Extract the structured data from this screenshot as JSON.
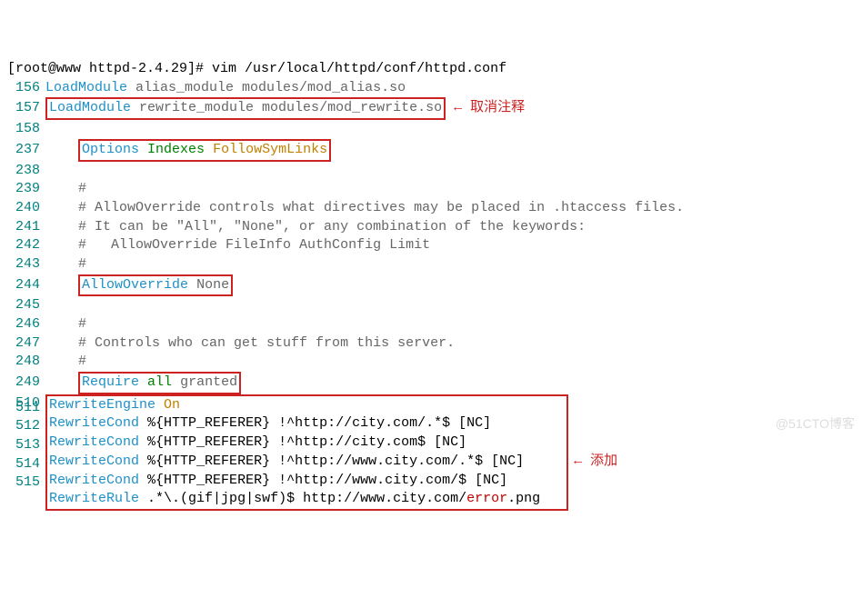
{
  "prompt": "[root@www httpd-2.4.29]# vim /usr/local/httpd/conf/httpd.conf",
  "lines": {
    "l156": {
      "num": "156",
      "kw": "LoadModule",
      "arg": "alias_module modules/mod_alias.so"
    },
    "l157": {
      "num": "157",
      "kw": "LoadModule",
      "arg": "rewrite_module modules/mod_rewrite.so"
    },
    "l158": {
      "num": "158"
    },
    "l237": {
      "num": "237",
      "a": "Options",
      "b": "Indexes",
      "c": "FollowSymLinks"
    },
    "l238": {
      "num": "238"
    },
    "l239": {
      "num": "239",
      "t": "#"
    },
    "l240": {
      "num": "240",
      "t": "# AllowOverride controls what directives may be placed in .htaccess files."
    },
    "l241": {
      "num": "241",
      "t": "# It can be \"All\", \"None\", or any combination of the keywords:"
    },
    "l242": {
      "num": "242",
      "t": "#   AllowOverride FileInfo AuthConfig Limit"
    },
    "l243": {
      "num": "243",
      "t": "#"
    },
    "l244": {
      "num": "244",
      "a": "AllowOverride",
      "b": "None"
    },
    "l245": {
      "num": "245"
    },
    "l246": {
      "num": "246",
      "t": "#"
    },
    "l247": {
      "num": "247",
      "t": "# Controls who can get stuff from this server."
    },
    "l248": {
      "num": "248",
      "t": "#"
    },
    "l249": {
      "num": "249",
      "a": "Require",
      "b": "all",
      "c": "granted"
    },
    "l510": {
      "num": "510",
      "a": "RewriteEngine",
      "b": "On"
    },
    "l511": {
      "num": "511",
      "a": "RewriteCond",
      "b": "%{HTTP_REFERER} !^http://city.com/.*$ [NC]"
    },
    "l512": {
      "num": "512",
      "a": "RewriteCond",
      "b": "%{HTTP_REFERER} !^http://city.com$ [NC]"
    },
    "l513": {
      "num": "513",
      "a": "RewriteCond",
      "b": "%{HTTP_REFERER} !^http://www.city.com/.*$ [NC]"
    },
    "l514": {
      "num": "514",
      "a": "RewriteCond",
      "b": "%{HTTP_REFERER} !^http://www.city.com/$ [NC]"
    },
    "l515": {
      "num": "515",
      "a": "RewriteRule",
      "b": ".*\\.(gif|jpg|swf)$ http://www.city.com/",
      "c": "error",
      "d": ".png"
    }
  },
  "notes": {
    "uncomment": "← 取消注释",
    "add": "← 添加"
  },
  "watermark": "@51CTO博客"
}
